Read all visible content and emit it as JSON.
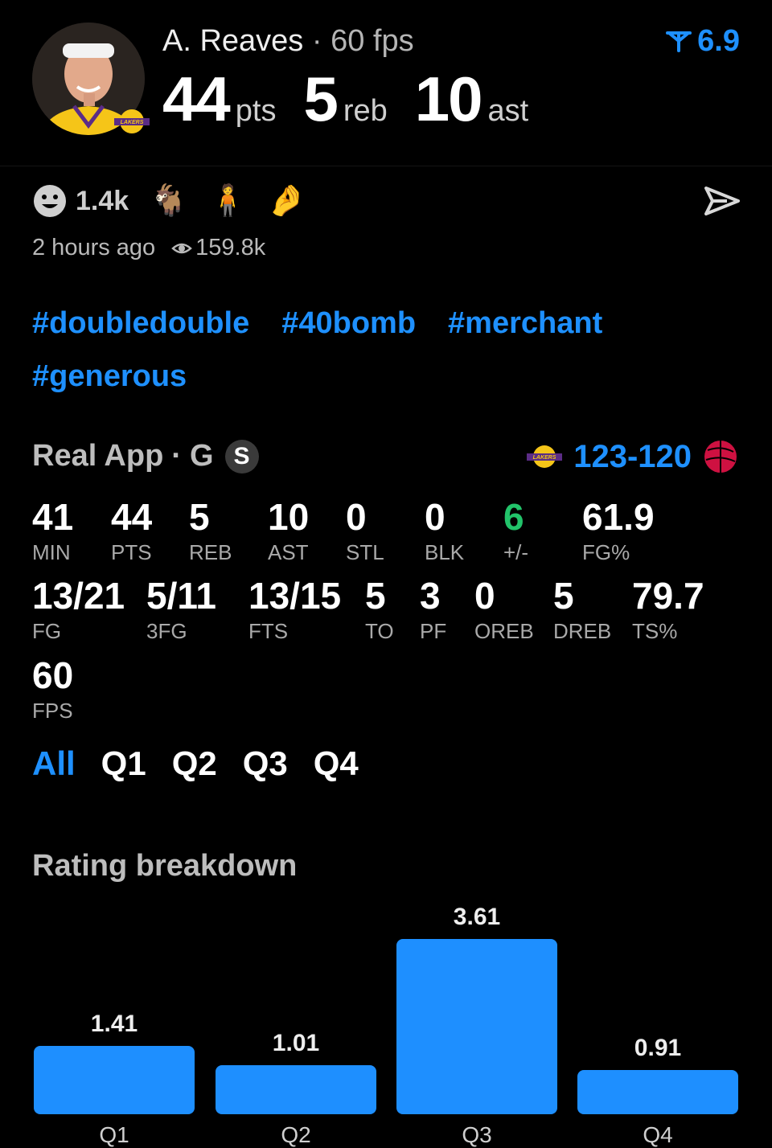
{
  "player": {
    "name": "A. Reaves",
    "separator": "·",
    "fps_text": "60 fps",
    "rating": "6.9",
    "team_logo_text": "LAKERS"
  },
  "headline": [
    {
      "value": "44",
      "unit": "pts"
    },
    {
      "value": "5",
      "unit": "reb"
    },
    {
      "value": "10",
      "unit": "ast"
    }
  ],
  "reactions": {
    "count": "1.4k",
    "emojis": [
      "goat-emoji",
      "person-emoji",
      "pinched-fingers-emoji"
    ]
  },
  "meta": {
    "time": "2 hours ago",
    "views": "159.8k"
  },
  "tags": [
    "#doubledouble",
    "#40bomb",
    "#merchant",
    "#generous"
  ],
  "game": {
    "source": "Real App",
    "separator": "·",
    "position": "G",
    "badge": "S",
    "home_logo_text": "LAKERS",
    "score": "123-120"
  },
  "stats": {
    "row1": [
      {
        "value": "41",
        "label": "MIN"
      },
      {
        "value": "44",
        "label": "PTS"
      },
      {
        "value": "5",
        "label": "REB"
      },
      {
        "value": "10",
        "label": "AST"
      },
      {
        "value": "0",
        "label": "STL"
      },
      {
        "value": "0",
        "label": "BLK"
      },
      {
        "value": "6",
        "label": "+/-"
      },
      {
        "value": "61.9",
        "label": "FG%"
      }
    ],
    "row2": [
      {
        "value": "13/21",
        "label": "FG"
      },
      {
        "value": "5/11",
        "label": "3FG"
      },
      {
        "value": "13/15",
        "label": "FTS"
      },
      {
        "value": "5",
        "label": "TO"
      },
      {
        "value": "3",
        "label": "PF"
      },
      {
        "value": "0",
        "label": "OREB"
      },
      {
        "value": "5",
        "label": "DREB"
      },
      {
        "value": "79.7",
        "label": "TS%"
      }
    ],
    "row3": [
      {
        "value": "60",
        "label": "FPS"
      }
    ]
  },
  "tabs": [
    "All",
    "Q1",
    "Q2",
    "Q3",
    "Q4"
  ],
  "breakdown_title": "Rating breakdown",
  "colors": {
    "accent": "#1e90ff",
    "bar": "#1e8fff",
    "positive": "#22c36a"
  },
  "chart_data": {
    "type": "bar",
    "categories": [
      "Q1",
      "Q2",
      "Q3",
      "Q4"
    ],
    "values": [
      1.41,
      1.01,
      3.61,
      0.91
    ],
    "value_labels": [
      "1.41",
      "1.01",
      "3.61",
      "0.91"
    ],
    "title": "Rating breakdown",
    "xlabel": "",
    "ylabel": "",
    "ylim": [
      0,
      3.61
    ]
  }
}
